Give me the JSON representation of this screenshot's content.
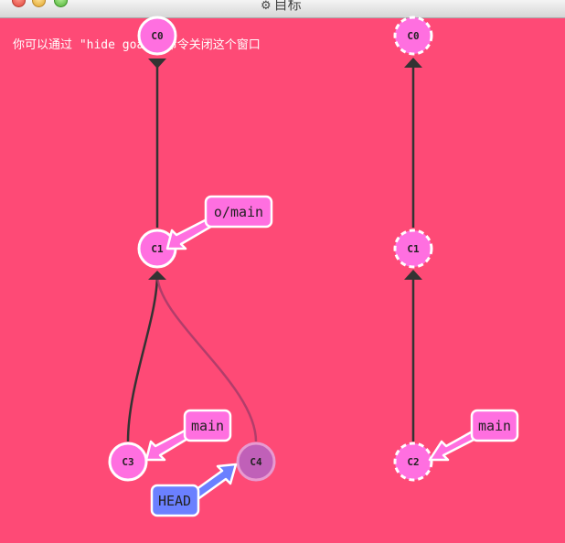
{
  "window": {
    "title": "目标",
    "title_icon": "gear-icon"
  },
  "hint": "你可以通过 \"hide goal\" 命令关闭这个窗口",
  "colors": {
    "background": "#fe4a76",
    "commit_fill": "#ff6fe0",
    "branch_fill": "#ff6fe0",
    "head_fill": "#6b80ff",
    "ghost_commit_fill": "#c060b8"
  },
  "current_tree": {
    "commits": [
      {
        "id": "C0",
        "label": "C0"
      },
      {
        "id": "C1",
        "label": "C1"
      },
      {
        "id": "C3",
        "label": "C3"
      },
      {
        "id": "C4",
        "label": "C4"
      }
    ],
    "labels": [
      {
        "id": "o-main",
        "text": "o/main",
        "target": "C1"
      },
      {
        "id": "main",
        "text": "main",
        "target": "C3"
      },
      {
        "id": "head",
        "text": "HEAD",
        "target": "C4"
      }
    ]
  },
  "goal_tree": {
    "commits": [
      {
        "id": "C0",
        "label": "C0"
      },
      {
        "id": "C1",
        "label": "C1"
      },
      {
        "id": "C2",
        "label": "C2"
      }
    ],
    "labels": [
      {
        "id": "main",
        "text": "main",
        "target": "C2"
      }
    ]
  }
}
